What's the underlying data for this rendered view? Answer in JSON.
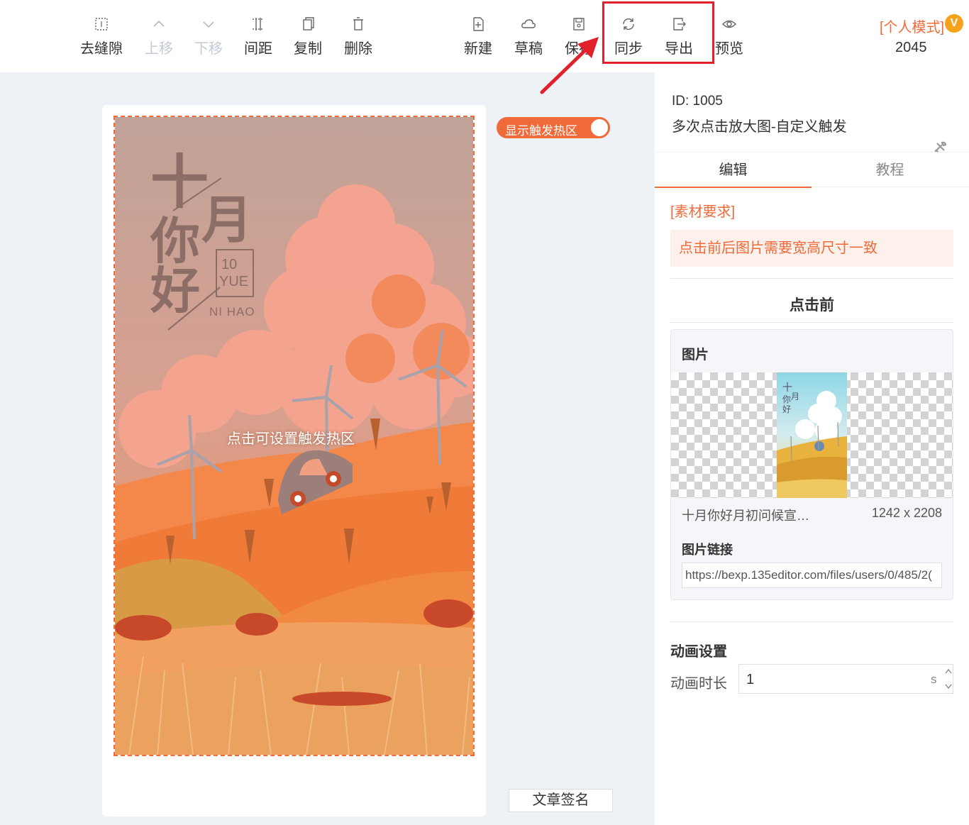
{
  "toolbar": {
    "items": [
      {
        "label": "去缝隙"
      },
      {
        "label": "上移"
      },
      {
        "label": "下移"
      },
      {
        "label": "间距"
      },
      {
        "label": "复制"
      },
      {
        "label": "删除"
      },
      {
        "label": "新建"
      },
      {
        "label": "草稿"
      },
      {
        "label": "保存"
      },
      {
        "label": "同步"
      },
      {
        "label": "导出"
      },
      {
        "label": "预览"
      }
    ],
    "mode_label": "[个人模式]",
    "mode_badge": "V",
    "mode_number": "2045"
  },
  "canvas": {
    "toggle_label": "显示触发热区",
    "hotspot_label": "点击可设置触发热区",
    "signature_button": "文章签名",
    "poster": {
      "title_1": "十",
      "title_2": "月",
      "title_3": "你",
      "title_4": "好",
      "stamp_1": "10",
      "stamp_2": "YUE",
      "subtitle": "NI HAO"
    }
  },
  "panel": {
    "id_text": "ID: 1005",
    "name": "多次点击放大图-自定义触发",
    "tabs": [
      {
        "label": "编辑"
      },
      {
        "label": "教程"
      }
    ],
    "requirement_title": "[素材要求]",
    "requirement_text": "点击前后图片需要宽高尺寸一致",
    "before_title": "点击前",
    "image_card": {
      "title": "图片",
      "file_name": "十月你好月初问候宣…",
      "file_size": "1242 x 2208",
      "link_title": "图片链接",
      "link_value": "https://bexp.135editor.com/files/users/0/485/2("
    },
    "animation": {
      "title": "动画设置",
      "duration_label": "动画时长",
      "duration_value": "1",
      "duration_unit": "s"
    }
  },
  "colors": {
    "accent": "#f06a3a",
    "highlight": "#e0202b"
  }
}
